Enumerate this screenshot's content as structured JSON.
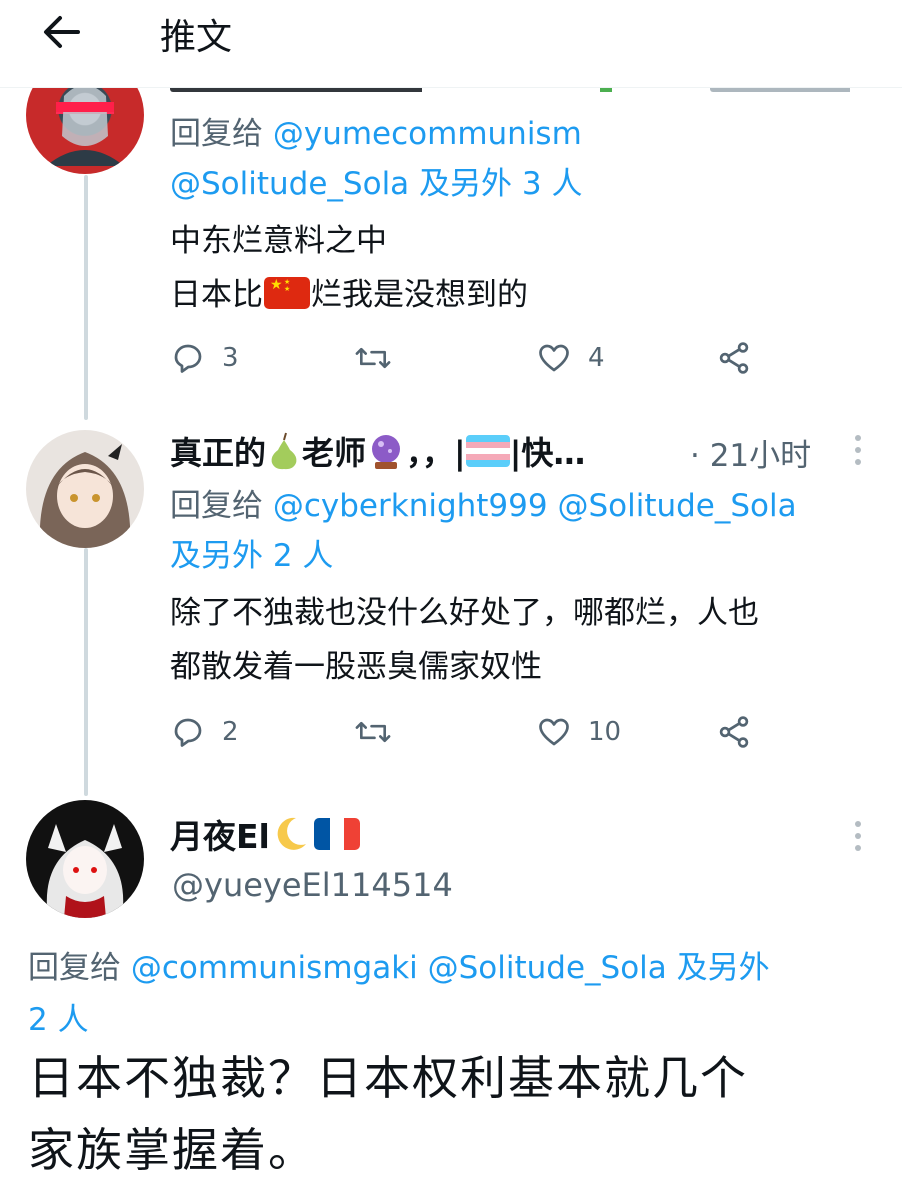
{
  "header": {
    "title": "推文"
  },
  "replies": [
    {
      "reply_label": "回复给",
      "mentions_line1": "@yumecommunism",
      "mentions_line2": "@Solitude_Sola",
      "others": "及另外 3 人",
      "text_line1": "中东烂意料之中",
      "text_line2_pre": "日本比",
      "text_line2_post": "烂我是没想到的",
      "replies_count": "3",
      "likes_count": "4"
    },
    {
      "display_name_pre": "真正的",
      "display_name_mid": "老师",
      "display_name_post": "，，|",
      "display_name_end": "|快…",
      "time": "· 21小时",
      "reply_label": "回复给",
      "mentions_line1": "@cyberknight999 @Solitude_Sola",
      "others": "及另外 2 人",
      "text_line1": "除了不独裁也没什么好处了，哪都烂，人也",
      "text_line2": "都散发着一股恶臭儒家奴性",
      "replies_count": "2",
      "likes_count": "10"
    }
  ],
  "main_tweet": {
    "display_name": "月夜El",
    "handle": "@yueyeEl114514",
    "reply_label": "回复给",
    "mentions": "@communismgaki @Solitude_Sola",
    "others_line1": "及另外",
    "others_line2": "2 人",
    "text_line1": "日本不独裁？日本权利基本就几个",
    "text_line2": "家族掌握着。"
  },
  "colors": {
    "accent": "#1d9bf0",
    "secondary_text": "#536471",
    "thread_line": "#cfd9de"
  }
}
